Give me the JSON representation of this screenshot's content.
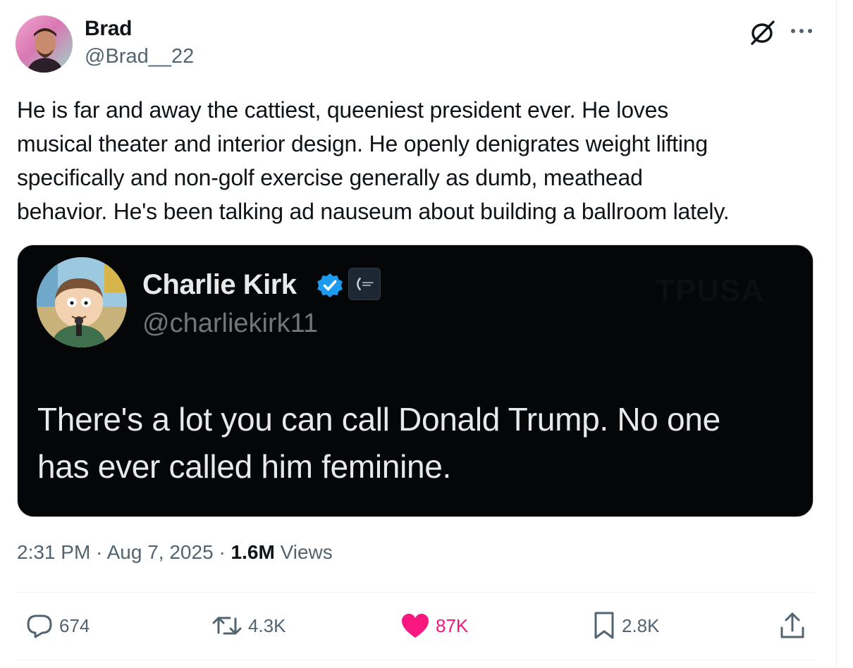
{
  "user": {
    "name": "Brad",
    "handle": "@Brad__22"
  },
  "tweet": {
    "text": "He is far and away the cattiest, queeniest president ever. He loves\nmusical theater and interior design. He openly denigrates weight lifting\nspecifically and non-golf exercise generally as dumb, meathead\nbehavior. He's been talking ad nauseum about building a ballroom lately."
  },
  "embedded_image": {
    "name": "Charlie Kirk",
    "handle": "@charliekirk11",
    "watermark": "TPUSA",
    "text": "There's a lot you can call Donald Trump. No one\nhas ever called him feminine."
  },
  "meta": {
    "time": "2:31 PM",
    "separator": "·",
    "date": "Aug 7, 2025",
    "views_count": "1.6M",
    "views_label": "Views"
  },
  "actions": {
    "replies": "674",
    "reposts": "4.3K",
    "likes": "87K",
    "bookmarks": "2.8K"
  },
  "colors": {
    "like_pink": "#f91880",
    "verified_blue": "#1d9bf0",
    "secondary_text": "#536471"
  },
  "icons": [
    "grok-icon",
    "more-icon",
    "verified-icon",
    "reply-icon",
    "repost-icon",
    "like-icon",
    "bookmark-icon",
    "share-icon"
  ]
}
